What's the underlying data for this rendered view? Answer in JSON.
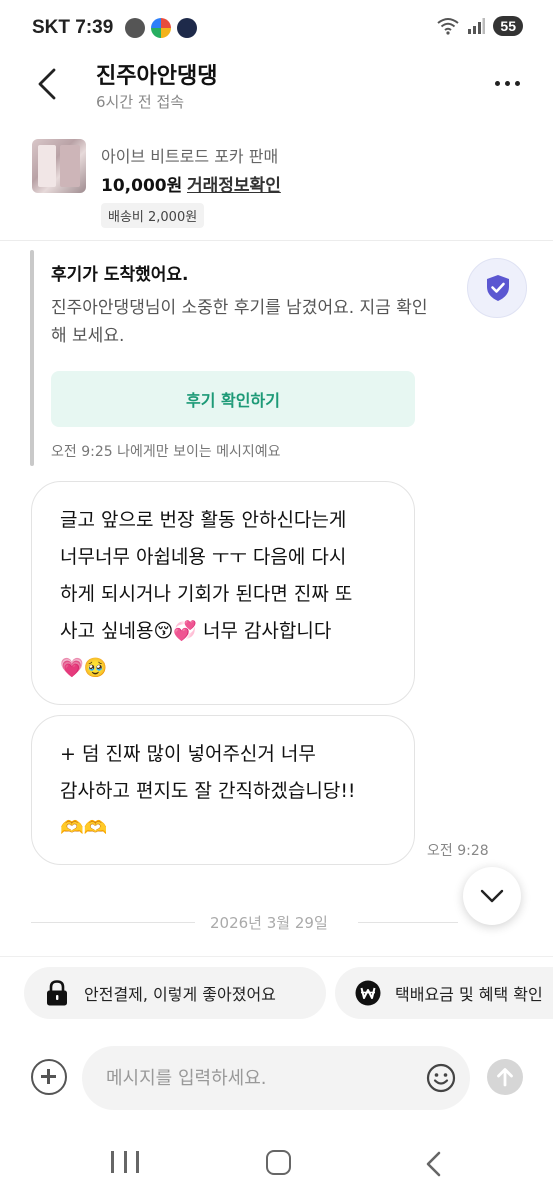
{
  "status_bar": {
    "carrier": "SKT",
    "time": "7:39",
    "battery": "55"
  },
  "header": {
    "title": "진주아안댕댕",
    "subtitle": "6시간 전 접속"
  },
  "product": {
    "name": "아이브 비트로드 포카 판매",
    "price": "10,000원",
    "trade_link": "거래정보확인",
    "shipping": "배송비 2,000원"
  },
  "review_notice": {
    "title": "후기가 도착했어요.",
    "body": "진주아안댕댕님이 소중한 후기를 남겼어요. 지금 확인해 보세요.",
    "button": "후기 확인하기",
    "footer": "오전 9:25  나에게만 보이는 메시지예요"
  },
  "messages": [
    {
      "lines": [
        "글고 앞으로 번장 활동 안하신다는게",
        "너무너무 아쉽네용 ㅜㅜ 다음에 다시",
        "하게 되시거나 기회가 된다면 진짜 또",
        "사고 싶네용😚💞 너무 감사합니다",
        "💗🥹"
      ]
    },
    {
      "lines": [
        "+ 덤 진짜 많이 넣어주신거 너무",
        "감사하고 편지도 잘 간직하겠습니당!!",
        "🫶🫶"
      ]
    }
  ],
  "message_time": "오전 9:28",
  "date_divider": "2026년 3월 29일",
  "chips": [
    {
      "label": "안전결제, 이렇게 좋아졌어요",
      "icon": "lock-icon"
    },
    {
      "label": "택배요금 및 혜택 확인",
      "icon": "won-icon"
    }
  ],
  "input": {
    "placeholder": "메시지를 입력하세요."
  },
  "colors": {
    "accent_green": "#1d9a77",
    "green_bg": "#e7f7f2",
    "shield_purple": "#5b57d1"
  }
}
